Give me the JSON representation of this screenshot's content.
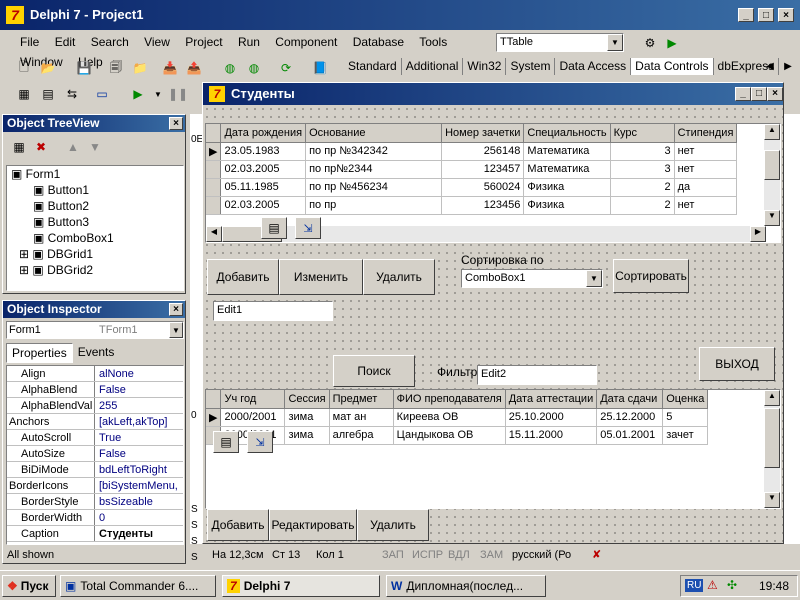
{
  "app": {
    "title": "Delphi 7 - Project1"
  },
  "menu": [
    "File",
    "Edit",
    "Search",
    "View",
    "Project",
    "Run",
    "Component",
    "Database",
    "Tools",
    "Window",
    "Help"
  ],
  "combo_top": "TTable",
  "palette_tabs": [
    "Standard",
    "Additional",
    "Win32",
    "System",
    "Data Access",
    "Data Controls",
    "dbExpress"
  ],
  "treeview": {
    "title": "Object TreeView",
    "items": [
      "Form1",
      "Button1",
      "Button2",
      "Button3",
      "ComboBox1",
      "DBGrid1",
      "DBGrid2"
    ]
  },
  "inspector": {
    "title": "Object Inspector",
    "object": "Form1",
    "object_type": "TForm1",
    "tabs": [
      "Properties",
      "Events"
    ],
    "props": [
      {
        "k": "Align",
        "v": "alNone"
      },
      {
        "k": "AlphaBlend",
        "v": "False"
      },
      {
        "k": "AlphaBlendVal",
        "v": "255"
      },
      {
        "k": "Anchors",
        "v": "[akLeft,akTop]"
      },
      {
        "k": "AutoScroll",
        "v": "True"
      },
      {
        "k": "AutoSize",
        "v": "False"
      },
      {
        "k": "BiDiMode",
        "v": "bdLeftToRight"
      },
      {
        "k": "BorderIcons",
        "v": "[biSystemMenu,"
      },
      {
        "k": "BorderStyle",
        "v": "bsSizeable"
      },
      {
        "k": "BorderWidth",
        "v": "0"
      },
      {
        "k": "Caption",
        "v": "Студенты"
      }
    ],
    "footer": "All shown"
  },
  "form": {
    "title": "Студенты",
    "grid1": {
      "headers": [
        "Дата рождения",
        "Основание",
        "Номер зачетки",
        "Специальность",
        "Курс",
        "Стипендия"
      ],
      "rows": [
        [
          "23.05.1983",
          "по пр №342342",
          "256148",
          "Математика",
          "3",
          "нет"
        ],
        [
          "02.03.2005",
          "по пр№2344",
          "123457",
          "Математика",
          "3",
          "нет"
        ],
        [
          "05.11.1985",
          "по пр №456234",
          "560024",
          "Физика",
          "2",
          "да"
        ],
        [
          "02.03.2005",
          "по пр",
          "123456",
          "Физика",
          "2",
          "нет"
        ]
      ]
    },
    "buttons1": [
      "Добавить",
      "Изменить",
      "Удалить"
    ],
    "sort_label": "Сортировка по",
    "sort_combo": "ComboBox1",
    "sort_button": "Сортировать",
    "edit1": "Edit1",
    "search_button": "Поиск",
    "filter_label": "Фильтр",
    "edit2": "Edit2",
    "exit_button": "ВЫХОД",
    "grid2": {
      "headers": [
        "Уч год",
        "Сессия",
        "Предмет",
        "ФИО преподавателя",
        "Дата аттестации",
        "Дата сдачи",
        "Оценка"
      ],
      "rows": [
        [
          "2000/2001",
          "зима",
          "мат ан",
          "Киреева ОВ",
          "25.10.2000",
          "25.12.2000",
          "5"
        ],
        [
          "2000/2001",
          "зима",
          "алгебра",
          "Цандыкова ОВ",
          "15.11.2000",
          "05.01.2001",
          "зачет"
        ]
      ]
    },
    "buttons2": [
      "Добавить",
      "Редактировать",
      "Удалить"
    ]
  },
  "statusbar": [
    "На 12,3см",
    "Ст 13",
    "Кол 1",
    "ЗАП",
    "ИСПР",
    "ВДЛ",
    "ЗАМ",
    "русский (Ро"
  ],
  "left_labels": [
    "0E",
    "0",
    "S",
    "S",
    "S",
    "S"
  ],
  "taskbar": {
    "start": "Пуск",
    "tasks": [
      "Total Commander 6....",
      "Delphi 7",
      "Дипломная(послед..."
    ],
    "lang": "RU",
    "time": "19:48"
  }
}
